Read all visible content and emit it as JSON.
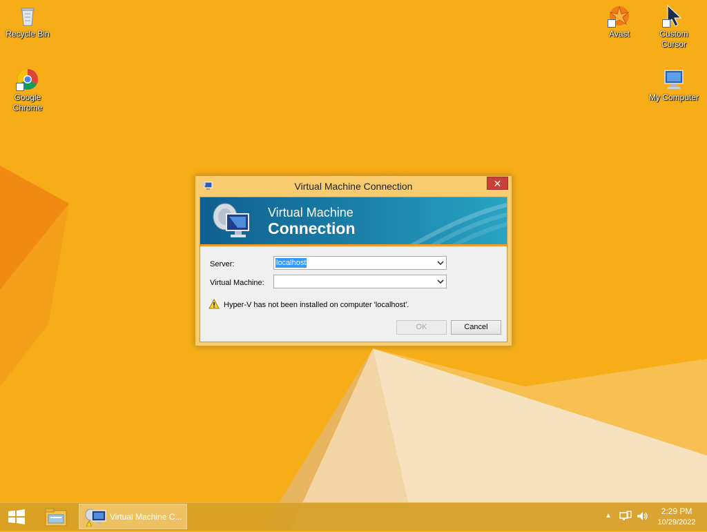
{
  "desktop": {
    "icons": {
      "recycle_bin": "Recycle Bin",
      "chrome": "Google Chrome",
      "avast": "Avast",
      "custom_cursor": "Custom Cursor",
      "my_computer": "My Computer"
    }
  },
  "dialog": {
    "title": "Virtual Machine Connection",
    "close_glyph": "✕",
    "banner": {
      "line1": "Virtual Machine",
      "line2": "Connection"
    },
    "server_label": "Server:",
    "server_value": "localhost",
    "vm_label": "Virtual Machine:",
    "vm_value": "",
    "warning": "Hyper-V has not been installed on computer 'localhost'.",
    "ok_label": "OK",
    "cancel_label": "Cancel"
  },
  "taskbar": {
    "active_task": "Virtual Machine C...",
    "tray_up": "▲",
    "time": "2:29 PM",
    "date": "10/29/2022"
  },
  "colors": {
    "wallpaper": "#f7b11a",
    "banner_blue": "#1b82a9",
    "banner_accent": "#f29a27",
    "close_red": "#c7413a"
  }
}
